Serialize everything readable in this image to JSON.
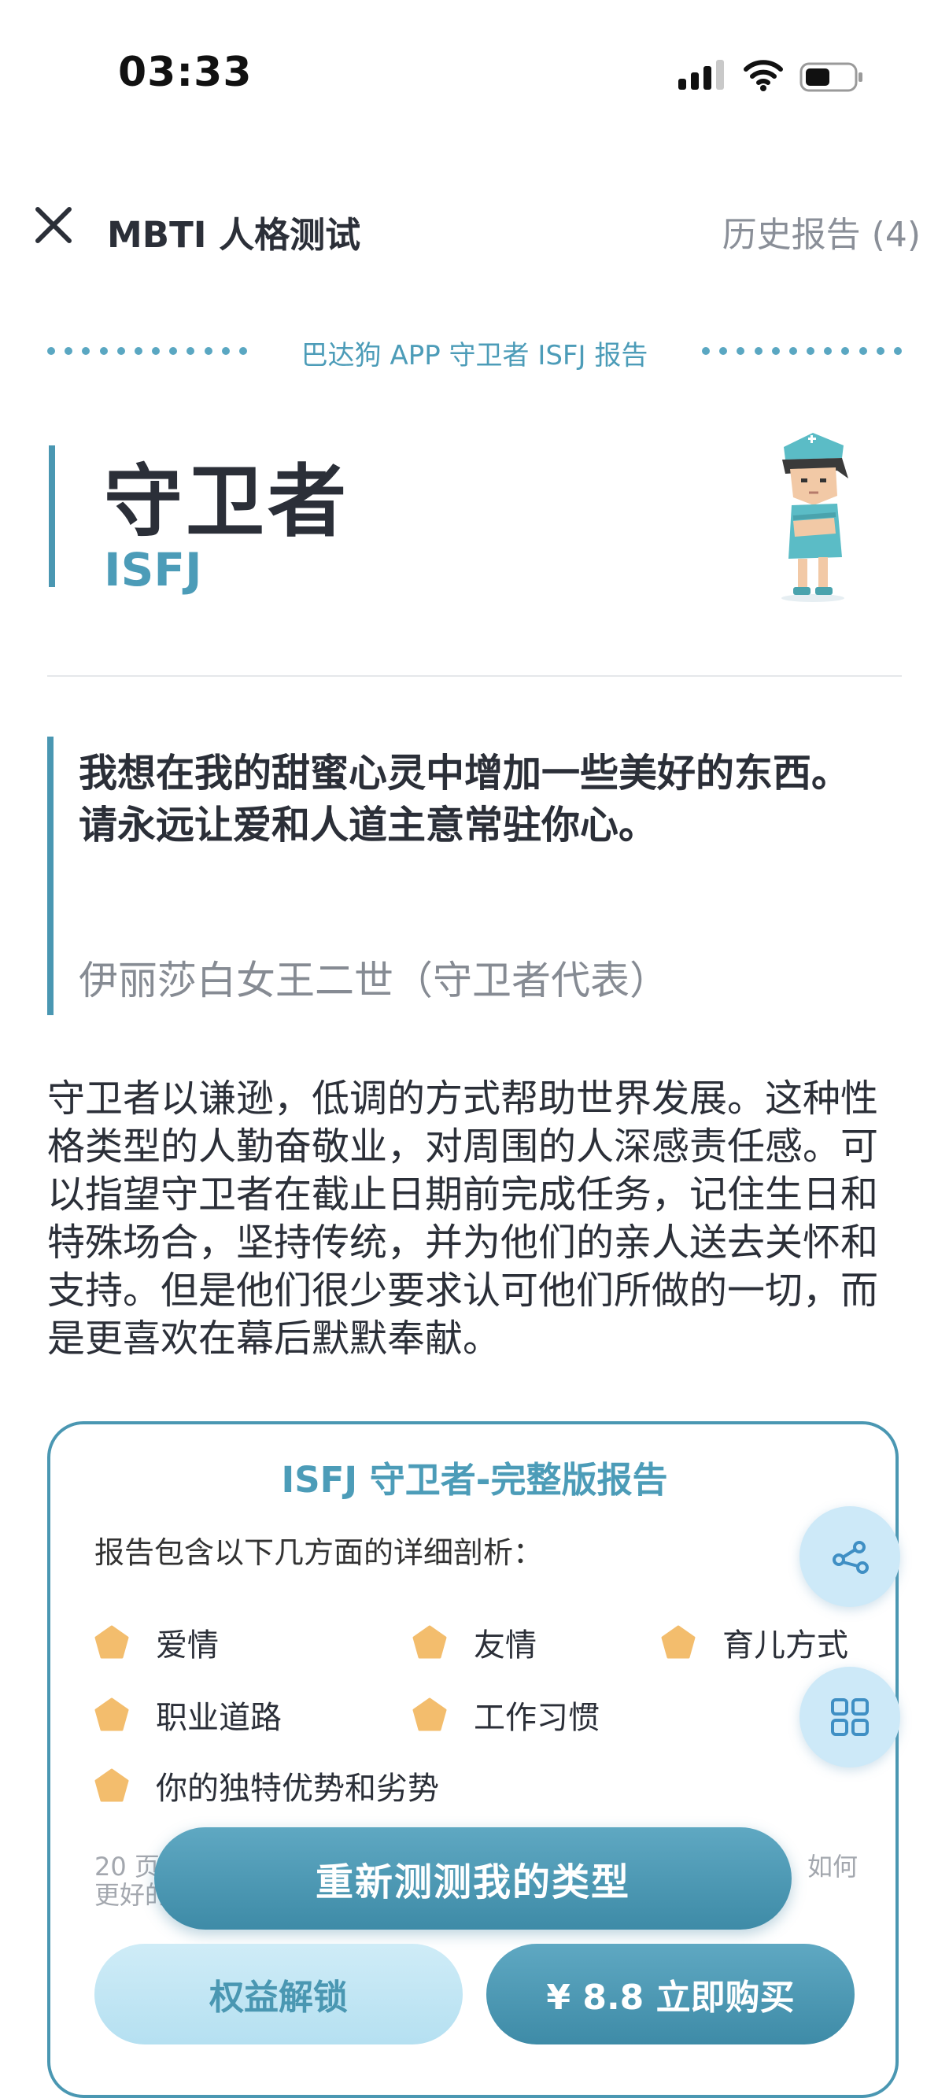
{
  "status_bar": {
    "time": "03:33"
  },
  "nav": {
    "title": "MBTI 人格测试",
    "history_label": "历史报告 (4)"
  },
  "banner": {
    "text": "巴达狗 APP 守卫者 ISFJ 报告"
  },
  "header": {
    "title": "守卫者",
    "code": "ISFJ"
  },
  "quote": {
    "text": "我想在我的甜蜜心灵中增加一些美好的东西。请永远让爱和人道主意常驻你心。",
    "author": "伊丽莎白女王二世（守卫者代表）"
  },
  "description": "守卫者以谦逊，低调的方式帮助世界发展。这种性格类型的人勤奋敬业，对周围的人深感责任感。可以指望守卫者在截止日期前完成任务，记住生日和特殊场合，坚持传统，并为他们的亲人送去关怀和支持。但是他们很少要求认可他们所做的一切，而是更喜欢在幕后默默奉献。",
  "report_card": {
    "title": "ISFJ 守卫者-完整版报告",
    "intro": "报告包含以下几方面的详细剖析：",
    "features": [
      "爱情",
      "友情",
      "育儿方式",
      "职业道路",
      "工作习惯",
      "你的独特优势和劣势"
    ],
    "note_left": "20 页",
    "note_right": "如何",
    "note_line2": "更好的"
  },
  "buttons": {
    "retest": "重新测测我的类型",
    "unlock": "权益解锁",
    "buy": "¥ 8.8 立即购买"
  },
  "icons": {
    "close": "close-icon",
    "share": "share-icon",
    "grid": "grid-icon",
    "signal": "cellular-signal-icon",
    "wifi": "wifi-icon",
    "battery": "battery-icon",
    "feature_bullet": "pentagon-icon"
  },
  "colors": {
    "accent": "#4a97b2",
    "accent_text": "#4c9cb8",
    "bullet": "#f3bd6d",
    "fab_bg": "#cde9f8"
  }
}
